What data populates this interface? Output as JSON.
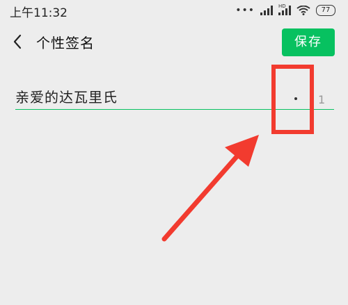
{
  "status_bar": {
    "time": "上午11:32",
    "network_badge": "HD",
    "battery_level": "77"
  },
  "nav": {
    "title": "个性签名",
    "save_label": "保存"
  },
  "signature": {
    "value": "亲爱的达瓦里氏",
    "char_count": "1"
  },
  "colors": {
    "accent": "#07c160",
    "annotation": "#f23b2f",
    "background": "#ededed"
  },
  "icons": [
    "back-chevron-icon",
    "signal-icon",
    "wifi-icon",
    "battery-icon"
  ]
}
